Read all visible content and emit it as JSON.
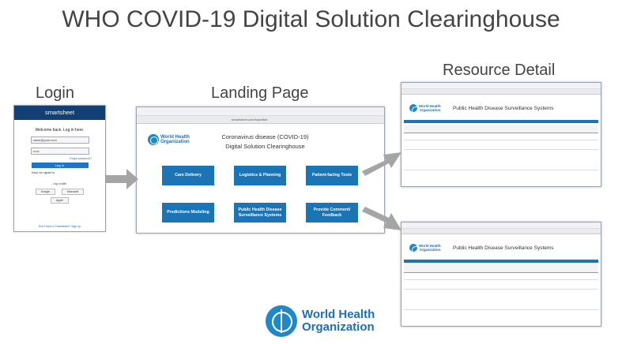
{
  "title": "WHO COVID-19 Digital Solution Clearinghouse",
  "labels": {
    "login": "Login",
    "landing": "Landing Page",
    "resource": "Resource Detail"
  },
  "login": {
    "brand": "smartsheet",
    "welcome": "Welcome back. Log in here.",
    "email_value": "name@your.com",
    "password_value": "••••••",
    "forgot": "Forgot password?",
    "button": "Log In",
    "remember": "Keep me signed in",
    "sso_label": "Log in with",
    "sso_google": "Google",
    "sso_microsoft": "Microsoft",
    "sso_apple": "Apple",
    "signup": "Don't have a Smartsheet? Sign up"
  },
  "landing": {
    "url": "smartsheet.com/b/publish",
    "org": [
      "World Health",
      "Organization"
    ],
    "heading1": "Coronavirus disease (COVID-19)",
    "heading2": "Digital Solution Clearinghouse",
    "tiles": [
      "Care Delivery",
      "Logistics & Planning",
      "Patient-facing Tools",
      "Predictions Modeling",
      "Public Health Disease Surveillance Systems",
      "Provide Comment/ Feedback"
    ]
  },
  "resource": {
    "org": [
      "World Health",
      "Organization"
    ],
    "title": "Public Health Disease Surveillance Systems"
  },
  "footer": {
    "org_line1": "World Health",
    "org_line2": "Organization"
  },
  "colors": {
    "brand_blue": "#1b74b6",
    "smartsheet_navy": "#123f74",
    "arrow_gray": "#a5a5a5"
  }
}
